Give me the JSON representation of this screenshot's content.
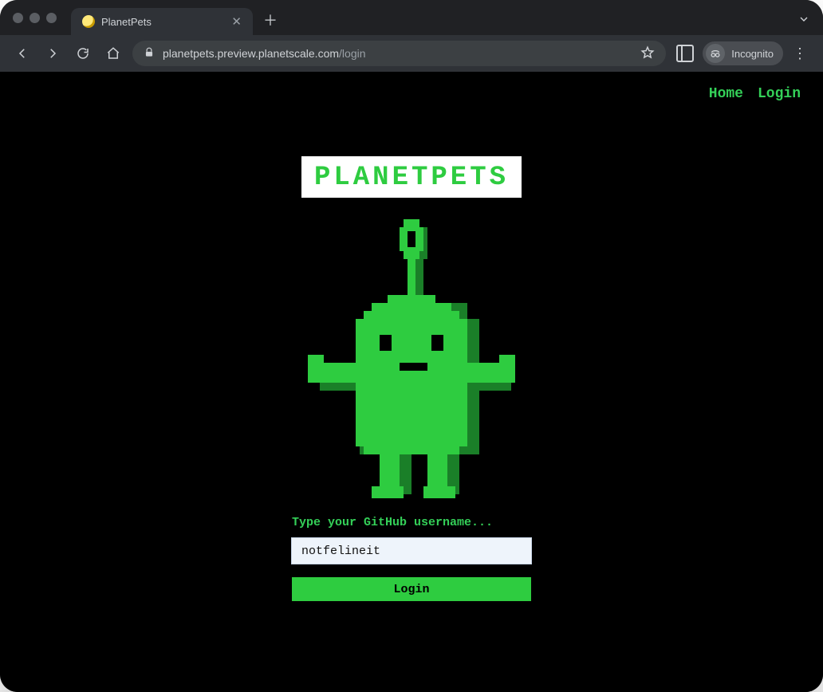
{
  "browser": {
    "tab_title": "PlanetPets",
    "url_host": "planetpets.preview.planetscale.com",
    "url_path": "/login",
    "incognito_label": "Incognito"
  },
  "nav": {
    "home": "Home",
    "login": "Login"
  },
  "logo_text": "PLANETPETS",
  "form": {
    "prompt": "Type your GitHub username...",
    "username_value": "notfelineit",
    "login_label": "Login"
  },
  "colors": {
    "accent": "#2ecc40",
    "accent_light": "#34d058",
    "accent_dark": "#1a7f28"
  }
}
